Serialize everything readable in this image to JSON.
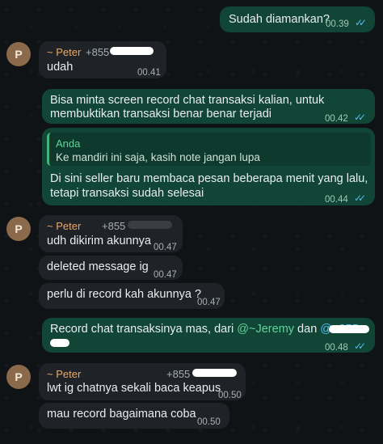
{
  "messages": {
    "m1": {
      "text": "Sudah diamankan?",
      "time": "00.39"
    },
    "m2": {
      "sender": "~ Peter",
      "phone": "+855",
      "text": "udah",
      "time": "00.41"
    },
    "m3": {
      "line1": "Bisa minta screen record chat transaksi kalian, untuk",
      "line2": "membuktikan transaksi benar benar terjadi",
      "time": "00.42"
    },
    "m4": {
      "quote_name": "Anda",
      "quote_text": "Ke mandiri ini saja, kasih note jangan lupa",
      "line1": "Di sini seller baru membaca pesan beberapa menit yang lalu,",
      "line2": "tetapi transaksi sudah selesai",
      "time": "00.44"
    },
    "m5": {
      "sender": "~ Peter",
      "phone": "+855",
      "text": "udh dikirim akunnya",
      "time": "00.47"
    },
    "m6": {
      "text": "deleted message ig",
      "time": "00.47"
    },
    "m7": {
      "text": "perlu di record kah akunnya ?",
      "time": "00.47"
    },
    "m8": {
      "text_prefix": "Record chat transaksinya mas, dari ",
      "mention1": "@~Jeremy",
      "text_mid": " dan ",
      "mention2": "@+855",
      "time": "00.48"
    },
    "m9": {
      "sender": "~ Peter",
      "phone": "+855",
      "text": "lwt ig chatnya sekali baca keapus",
      "time": "00.50"
    },
    "m10": {
      "text": "mau record bagaimana coba",
      "time": "00.50"
    }
  },
  "avatar_letter": "P",
  "ticks": "✓✓",
  "colors": {
    "incoming": "#1f2226",
    "outgoing": "#114535",
    "sender": "#e8a96b",
    "ticks": "#53bdeb"
  }
}
